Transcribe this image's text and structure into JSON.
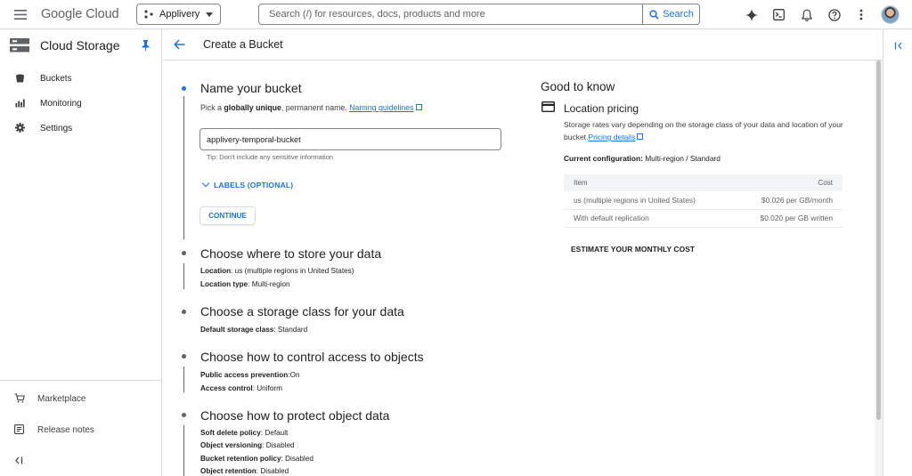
{
  "topbar": {
    "brand_google": "Google",
    "brand_cloud": "Cloud",
    "project_name": "Applivery",
    "search_placeholder": "Search (/) for resources, docs, products and more",
    "search_button": "Search"
  },
  "leftnav": {
    "title": "Cloud Storage",
    "items": [
      {
        "label": "Buckets",
        "icon": "bucket-icon"
      },
      {
        "label": "Monitoring",
        "icon": "bar-chart-icon"
      },
      {
        "label": "Settings",
        "icon": "gear-icon"
      }
    ],
    "bottom_items": [
      {
        "label": "Marketplace",
        "icon": "cart-icon"
      },
      {
        "label": "Release notes",
        "icon": "notes-icon"
      }
    ]
  },
  "header": {
    "title": "Create a Bucket"
  },
  "steps": {
    "name": {
      "title": "Name your bucket",
      "desc_prefix": "Pick a ",
      "desc_bold": "globally unique",
      "desc_suffix": ", permanent name. ",
      "link": "Naming guidelines",
      "input_value": "applivery-temporal-bucket",
      "tip": "Tip: Don't include any sensitive information",
      "labels_toggle": "LABELS (OPTIONAL)",
      "continue": "CONTINUE"
    },
    "location": {
      "title": "Choose where to store your data",
      "rows": [
        {
          "key": "Location",
          "value": ": us (multiple regions in United States)"
        },
        {
          "key": "Location type",
          "value": ": Multi-region"
        }
      ]
    },
    "storage_class": {
      "title": "Choose a storage class for your data",
      "rows": [
        {
          "key": "Default storage class",
          "value": ": Standard"
        }
      ]
    },
    "access": {
      "title": "Choose how to control access to objects",
      "rows": [
        {
          "key": "Public access prevention",
          "value": ":On"
        },
        {
          "key": "Access control",
          "value": ": Uniform"
        }
      ]
    },
    "protect": {
      "title": "Choose how to protect object data",
      "rows": [
        {
          "key": "Soft delete policy",
          "value": ": Default"
        },
        {
          "key": "Object versioning",
          "value": ": Disabled"
        },
        {
          "key": "Bucket retention policy",
          "value": ": Disabled"
        },
        {
          "key": "Object retention",
          "value": ": Disabled"
        }
      ]
    }
  },
  "good_to_know": {
    "title": "Good to know",
    "pricing_title": "Location pricing",
    "pricing_desc": "Storage rates vary depending on the storage class of your data and location of your bucket.",
    "pricing_link": "Pricing details",
    "config_label": "Current configuration:",
    "config_value": " Multi-region / Standard",
    "table": {
      "headers": [
        "Item",
        "Cost"
      ],
      "rows": [
        [
          "us (multiple regions in United States)",
          "$0.026 per GB/month"
        ],
        [
          "With default replication",
          "$0.020 per GB written"
        ]
      ]
    },
    "estimate": "ESTIMATE YOUR MONTHLY COST"
  },
  "colors": {
    "accent": "#1a73e8",
    "border": "#dadce0",
    "text": "#202124",
    "muted": "#5f6368"
  }
}
